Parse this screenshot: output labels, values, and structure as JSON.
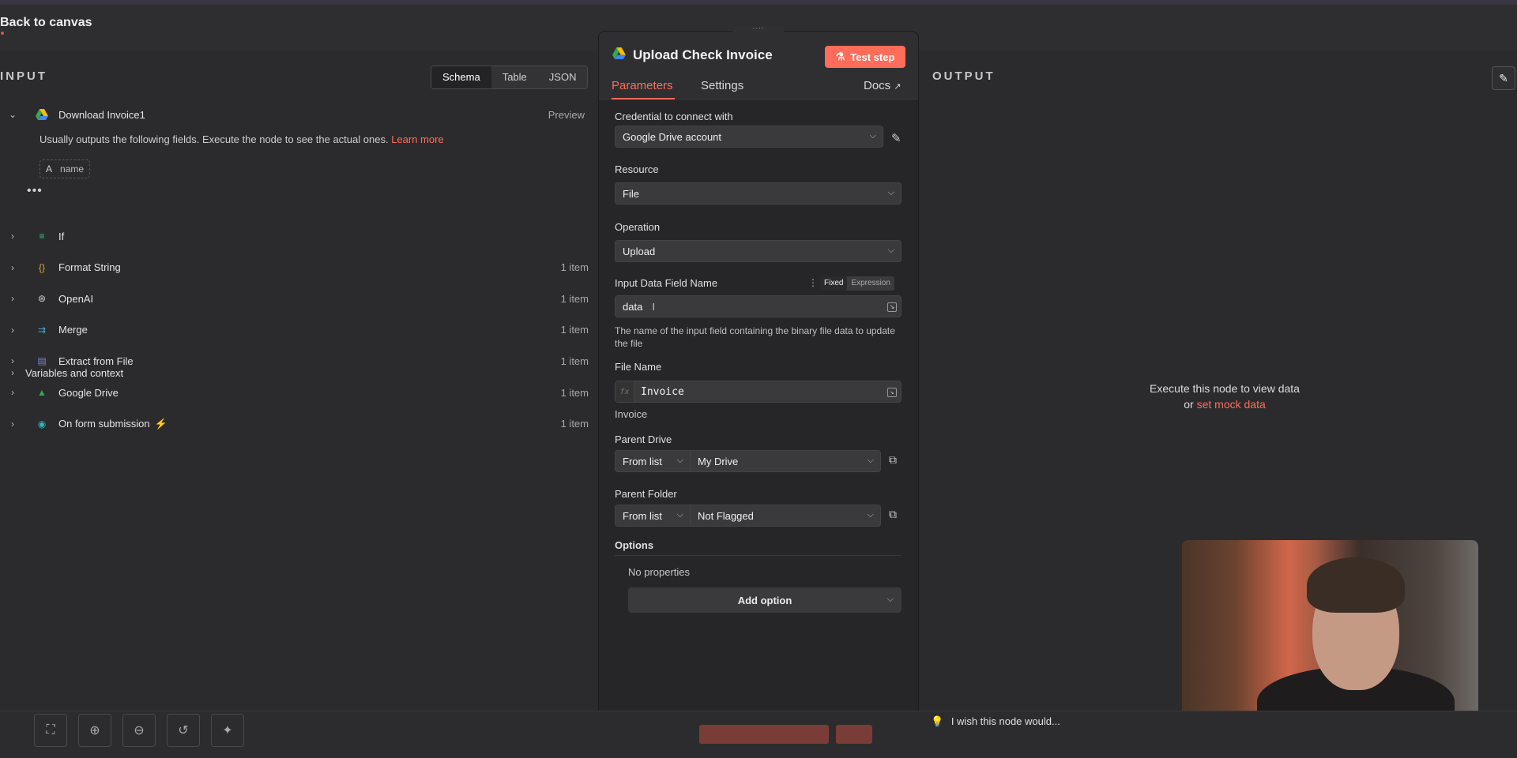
{
  "topbar": {
    "back_label": "Back to canvas"
  },
  "input": {
    "title": "INPUT",
    "view_tabs": [
      "Schema",
      "Table",
      "JSON"
    ],
    "active_view": "Schema",
    "expanded_node": {
      "label": "Download Invoice1",
      "action": "Preview"
    },
    "usually_text": "Usually outputs the following fields. Execute the node to see the actual ones.",
    "learn_more": "Learn more",
    "field": {
      "type": "A",
      "name": "name"
    },
    "more": "•••",
    "nodes": [
      {
        "label": "If",
        "count": "",
        "icon": "if-icon",
        "color": "#35c17a"
      },
      {
        "label": "Format String",
        "count": "1 item",
        "icon": "code-icon",
        "color": "#e5a33a"
      },
      {
        "label": "OpenAI",
        "count": "1 item",
        "icon": "openai-icon",
        "color": "#d0d0d0"
      },
      {
        "label": "Merge",
        "count": "1 item",
        "icon": "merge-icon",
        "color": "#41a6d8"
      },
      {
        "label": "Extract from File",
        "count": "1 item",
        "icon": "file-icon",
        "color": "#7a84d6"
      },
      {
        "label": "Google Drive",
        "count": "1 item",
        "icon": "google-drive-icon",
        "color": "#34a853"
      },
      {
        "label": "On form submission",
        "count": "1 item",
        "icon": "form-icon",
        "color": "#2fb5b5"
      }
    ],
    "variables": "Variables and context"
  },
  "modal": {
    "handle": "::::",
    "title": "Upload Check Invoice",
    "test_step": "Test step",
    "tabs": {
      "parameters": "Parameters",
      "settings": "Settings",
      "docs": "Docs"
    },
    "credential": {
      "label": "Credential to connect with",
      "value": "Google Drive account"
    },
    "resource": {
      "label": "Resource",
      "value": "File"
    },
    "operation": {
      "label": "Operation",
      "value": "Upload"
    },
    "input_field": {
      "label": "Input Data Field Name",
      "mode_fixed": "Fixed",
      "mode_expression": "Expression",
      "value": "data",
      "hint": "The name of the input field containing the binary file data to update the file"
    },
    "file_name": {
      "label": "File Name",
      "fx": "fx",
      "value": "Invoice",
      "preview": "Invoice"
    },
    "parent_drive": {
      "label": "Parent Drive",
      "mode": "From list",
      "value": "My Drive"
    },
    "parent_folder": {
      "label": "Parent Folder",
      "mode": "From list",
      "value": "Not Flagged"
    },
    "options": {
      "label": "Options",
      "empty": "No properties",
      "add": "Add option"
    }
  },
  "output": {
    "title": "OUTPUT",
    "empty_line1": "Execute this node to view data",
    "empty_or": "or",
    "mock_link": "set mock data"
  },
  "bottom": {
    "wish": "I wish this node would..."
  },
  "colors": {
    "accent": "#ff6d5a",
    "background": "#2b2b2d",
    "panel": "#262628"
  }
}
